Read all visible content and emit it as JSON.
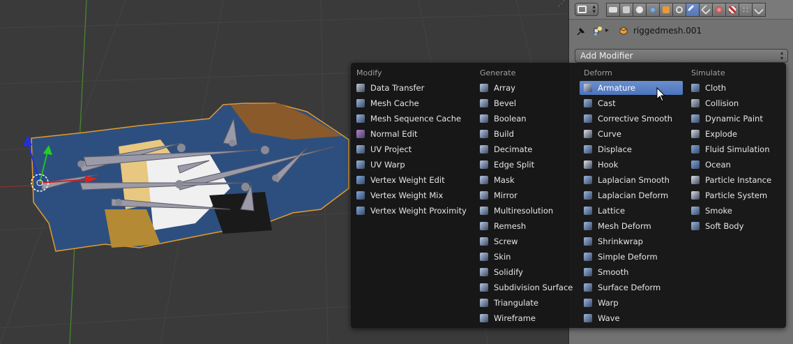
{
  "properties": {
    "breadcrumb_object": "riggedmesh.001",
    "add_modifier_label": "Add Modifier"
  },
  "menu": {
    "columns": [
      {
        "title": "Modify",
        "items": [
          {
            "label": "Data Transfer",
            "icon": "data-transfer-icon"
          },
          {
            "label": "Mesh Cache",
            "icon": "mesh-cache-icon"
          },
          {
            "label": "Mesh Sequence Cache",
            "icon": "mesh-sequence-cache-icon"
          },
          {
            "label": "Normal Edit",
            "icon": "normal-edit-icon"
          },
          {
            "label": "UV Project",
            "icon": "uv-project-icon"
          },
          {
            "label": "UV Warp",
            "icon": "uv-warp-icon"
          },
          {
            "label": "Vertex Weight Edit",
            "icon": "vertex-weight-icon"
          },
          {
            "label": "Vertex Weight Mix",
            "icon": "vertex-weight-icon"
          },
          {
            "label": "Vertex Weight Proximity",
            "icon": "vertex-weight-icon"
          }
        ]
      },
      {
        "title": "Generate",
        "items": [
          {
            "label": "Array",
            "icon": "array-icon"
          },
          {
            "label": "Bevel",
            "icon": "bevel-icon"
          },
          {
            "label": "Boolean",
            "icon": "boolean-icon"
          },
          {
            "label": "Build",
            "icon": "build-icon"
          },
          {
            "label": "Decimate",
            "icon": "decimate-icon"
          },
          {
            "label": "Edge Split",
            "icon": "edge-split-icon"
          },
          {
            "label": "Mask",
            "icon": "mask-icon"
          },
          {
            "label": "Mirror",
            "icon": "mirror-icon"
          },
          {
            "label": "Multiresolution",
            "icon": "multiresolution-icon"
          },
          {
            "label": "Remesh",
            "icon": "remesh-icon"
          },
          {
            "label": "Screw",
            "icon": "screw-icon"
          },
          {
            "label": "Skin",
            "icon": "skin-icon"
          },
          {
            "label": "Solidify",
            "icon": "solidify-icon"
          },
          {
            "label": "Subdivision Surface",
            "icon": "subdivision-surface-icon"
          },
          {
            "label": "Triangulate",
            "icon": "triangulate-icon"
          },
          {
            "label": "Wireframe",
            "icon": "wireframe-icon"
          }
        ]
      },
      {
        "title": "Deform",
        "items": [
          {
            "label": "Armature",
            "icon": "armature-icon",
            "highlighted": true
          },
          {
            "label": "Cast",
            "icon": "cast-icon"
          },
          {
            "label": "Corrective Smooth",
            "icon": "smooth-icon"
          },
          {
            "label": "Curve",
            "icon": "curve-icon"
          },
          {
            "label": "Displace",
            "icon": "displace-icon"
          },
          {
            "label": "Hook",
            "icon": "hook-icon"
          },
          {
            "label": "Laplacian Smooth",
            "icon": "smooth-icon"
          },
          {
            "label": "Laplacian Deform",
            "icon": "laplacian-deform-icon"
          },
          {
            "label": "Lattice",
            "icon": "lattice-icon"
          },
          {
            "label": "Mesh Deform",
            "icon": "mesh-deform-icon"
          },
          {
            "label": "Shrinkwrap",
            "icon": "shrinkwrap-icon"
          },
          {
            "label": "Simple Deform",
            "icon": "simple-deform-icon"
          },
          {
            "label": "Smooth",
            "icon": "smooth-icon"
          },
          {
            "label": "Surface Deform",
            "icon": "surface-deform-icon"
          },
          {
            "label": "Warp",
            "icon": "warp-icon"
          },
          {
            "label": "Wave",
            "icon": "wave-icon"
          }
        ]
      },
      {
        "title": "Simulate",
        "items": [
          {
            "label": "Cloth",
            "icon": "cloth-icon"
          },
          {
            "label": "Collision",
            "icon": "collision-icon"
          },
          {
            "label": "Dynamic Paint",
            "icon": "dynamic-paint-icon"
          },
          {
            "label": "Explode",
            "icon": "explode-icon"
          },
          {
            "label": "Fluid Simulation",
            "icon": "fluid-icon"
          },
          {
            "label": "Ocean",
            "icon": "ocean-icon"
          },
          {
            "label": "Particle Instance",
            "icon": "particles-icon"
          },
          {
            "label": "Particle System",
            "icon": "particles-icon"
          },
          {
            "label": "Smoke",
            "icon": "smoke-icon"
          },
          {
            "label": "Soft Body",
            "icon": "soft-body-icon"
          }
        ]
      }
    ]
  },
  "colors": {
    "highlight": "#5b80c4",
    "menu_bg": "#161616",
    "panel_bg": "#727272"
  }
}
